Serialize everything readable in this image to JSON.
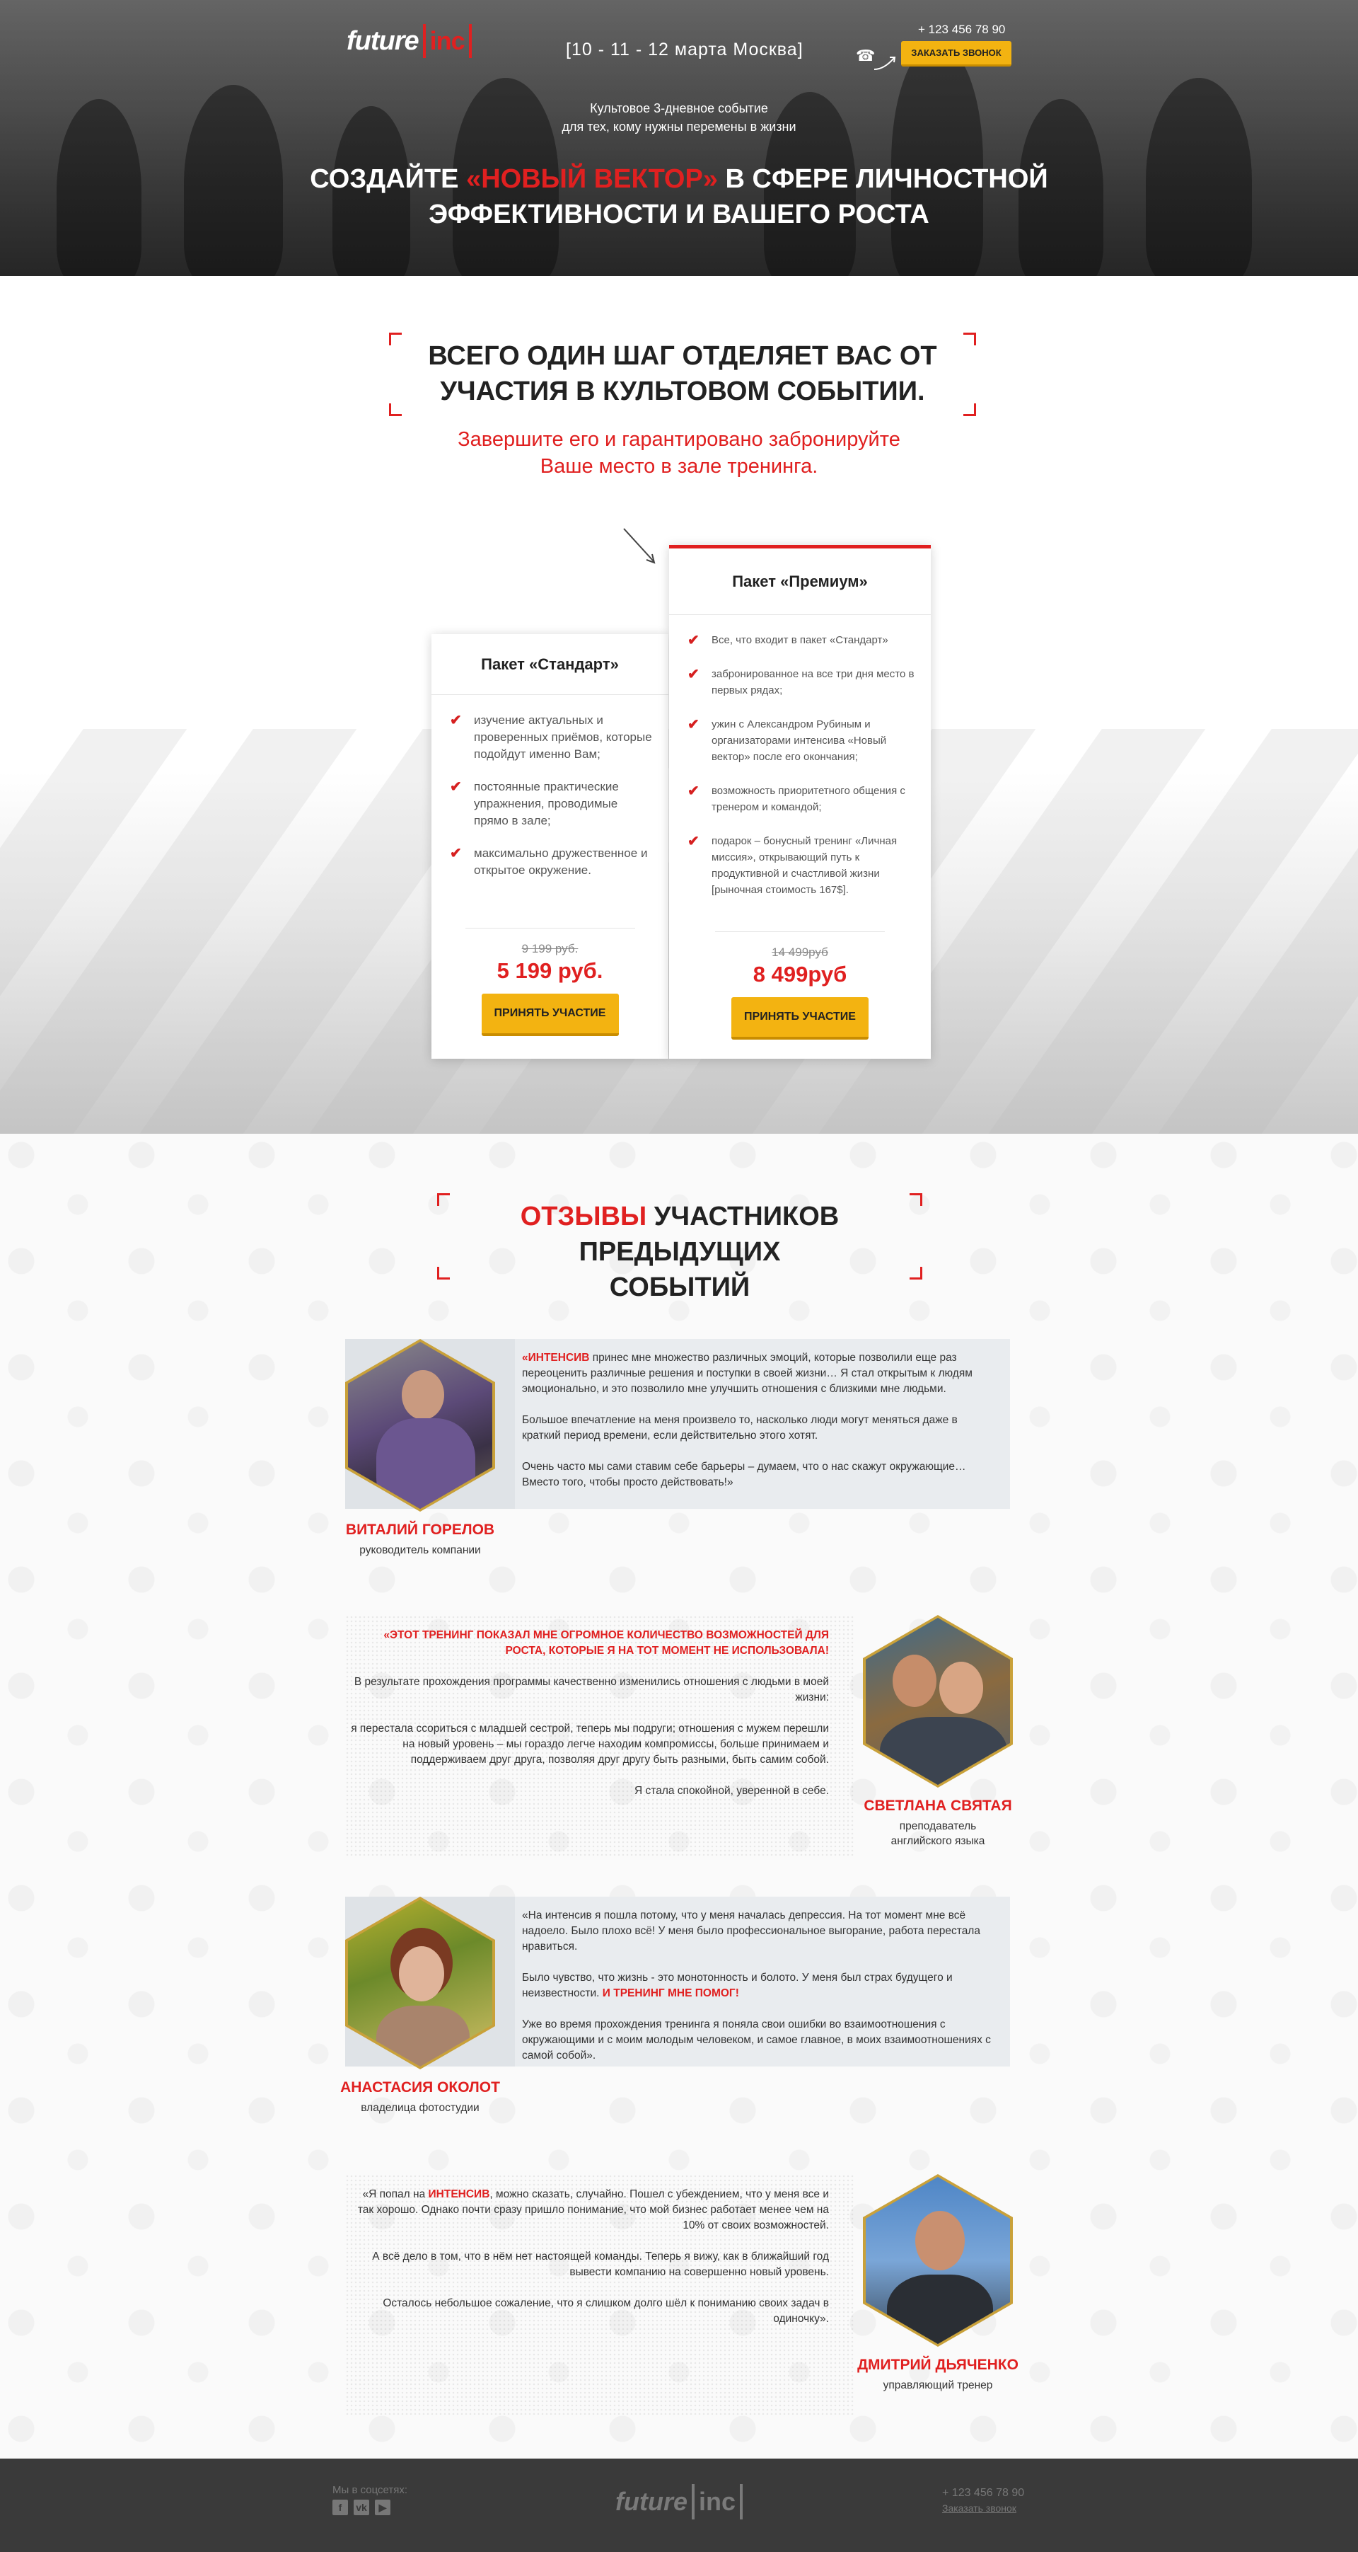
{
  "header": {
    "logo_text": "future",
    "logo_inc": "inc",
    "event_dates": "[10 - 11 - 12 марта Москва]",
    "phone": "+ 123 456 78 90",
    "call_button": "ЗАКАЗАТЬ ЗВОНОК",
    "subtitle_line1": "Культовое 3-дневное событие",
    "subtitle_line2": "для тех, кому нужны перемены в жизни",
    "title_part1": "Создайте ",
    "title_accent": "«новый вектор»",
    "title_part2": " в сфере личностной",
    "title_line2": "эффективности и вашего роста"
  },
  "pricing": {
    "title_line1": "ВСЕГО ОДИН ШАГ ОТДЕЛЯЕТ ВАС ОТ",
    "title_line2": "УЧАСТИЯ В КУЛЬТОВОМ СОБЫТИИ.",
    "sub_line1": "Завершите его и гарантировано забронируйте",
    "sub_line2": "Ваше место в зале тренинга.",
    "standard": {
      "name": "Пакет «Стандарт»",
      "features": [
        "изучение актуальных и проверенных приёмов, которые подойдут именно Вам;",
        "постоянные практические упражнения, проводимые прямо в зале;",
        "максимально дружественное и открытое окружение."
      ],
      "old_price": "9 199 руб.",
      "new_price": "5 199 руб.",
      "button": "ПРИНЯТЬ УЧАСТИЕ"
    },
    "premium": {
      "name": "Пакет «Премиум»",
      "features": [
        "Все, что входит в пакет «Стандарт»",
        "забронированное на все три дня место в первых рядах;",
        "ужин с Александром Рубиным и организаторами интенсива «Новый вектор» после его окончания;",
        "возможность приоритетного общения с тренером и командой;",
        "подарок – бонусный тренинг «Личная миссия», открывающий путь к продуктивной и счастливой жизни [рыночная стоимость 167$]."
      ],
      "old_price": "14 499руб",
      "new_price": "8 499руб",
      "button": "ПРИНЯТЬ УЧАСТИЕ"
    }
  },
  "reviews": {
    "title_accent": "ОТЗЫВЫ",
    "title_rest": " УЧАСТНИКОВ ПРЕДЫДУЩИХ",
    "title_line2": "СОБЫТИЙ",
    "items": [
      {
        "name": "ВИТАЛИЙ ГОРЕЛОВ",
        "role": "руководитель компании",
        "p1_red": "«ИНТЕНСИВ",
        "p1": " принес мне множество различных эмоций, которые позволили еще раз переоценить различные решения и поступки в своей жизни… Я стал открытым к людям эмоционально, и это позволило мне улучшить отношения с близкими мне людьми.",
        "p2": "Большое впечатление на меня произвело то, насколько люди могут меняться даже в краткий период времени, если действительно этого хотят.",
        "p3": "Очень часто мы сами ставим себе барьеры – думаем, что о нас скажут окружающие… Вместо того, чтобы просто действовать!»"
      },
      {
        "name": "СВЕТЛАНА СВЯТАЯ",
        "role_line1": "преподаватель",
        "role_line2": "английского языка",
        "p1_red": "«ЭТОТ ТРЕНИНГ ПОКАЗАЛ МНЕ ОГРОМНОЕ КОЛИЧЕСТВО ВОЗМОЖНОСТЕЙ ДЛЯ РОСТА, КОТОРЫЕ Я НА ТОТ МОМЕНТ НЕ ИСПОЛЬЗОВАЛА!",
        "p2": "В результате прохождения программы качественно изменились отношения с людьми в моей жизни:",
        "p3": "я перестала ссориться с младшей сестрой, теперь мы подруги; отношения с мужем перешли на новый уровень – мы гораздо легче находим компромиссы, больше принимаем и поддерживаем друг друга, позволяя друг другу быть разными, быть самим собой.",
        "p4": "Я стала спокойной, уверенной в себе."
      },
      {
        "name": "АНАСТАСИЯ ОКОЛОТ",
        "role": "владелица фотостудии",
        "p1": "«На интенсив я пошла потому, что у меня началась депрессия. На тот момент мне всё надоело. Было плохо всё! У меня было профессиональное выгорание, работа перестала нравиться.",
        "p2": "Было чувство, что жизнь - это монотонность и болото. У меня был страх будущего и неизвестности. ",
        "p2_red": "И ТРЕНИНГ МНЕ ПОМОГ!",
        "p3": "Уже во время прохождения тренинга я поняла свои ошибки во взаимоотношения с окружающими и с моим молодым человеком, и самое главное, в моих взаимоотношениях с самой собой»."
      },
      {
        "name": "ДМИТРИЙ ДЬЯЧЕНКО",
        "role": "управляющий тренер",
        "p1a": "«Я попал на ",
        "p1_red": "ИНТЕНСИВ",
        "p1b": ", можно сказать, случайно. Пошел с убеждением, что у меня все и так хорошо. Однако почти сразу пришло понимание, что мой бизнес работает менее чем на 10% от своих возможностей.",
        "p2": "А всё дело в том, что в нём нет настоящей команды. Теперь я вижу, как в ближайший год вывести компанию на совершенно новый уровень.",
        "p3": "Осталось небольшое сожаление, что я слишком долго шёл к пониманию своих задач в одиночку»."
      }
    ]
  },
  "footer": {
    "social_label": "Мы в соцсетях:",
    "logo_text": "future",
    "logo_inc": "inc",
    "phone": "+ 123 456 78 90",
    "call_link": "Заказать звонок"
  },
  "colors": {
    "accent_red": "#e02020",
    "button_yellow": "#f3b311",
    "footer_bg": "#3a3a3a"
  }
}
